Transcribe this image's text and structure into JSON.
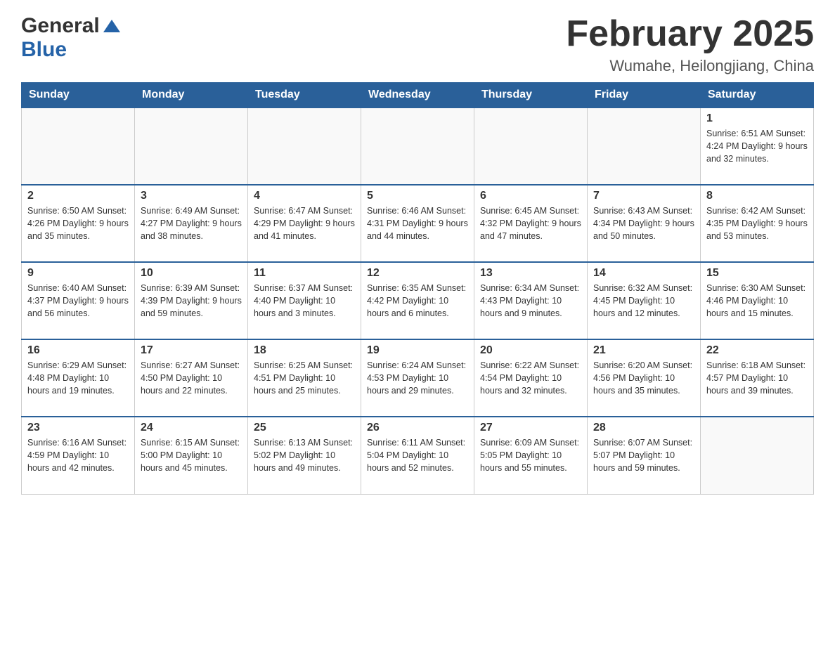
{
  "logo": {
    "general": "General",
    "blue": "Blue"
  },
  "header": {
    "title": "February 2025",
    "location": "Wumahe, Heilongjiang, China"
  },
  "weekdays": [
    "Sunday",
    "Monday",
    "Tuesday",
    "Wednesday",
    "Thursday",
    "Friday",
    "Saturday"
  ],
  "weeks": [
    [
      {
        "day": "",
        "info": ""
      },
      {
        "day": "",
        "info": ""
      },
      {
        "day": "",
        "info": ""
      },
      {
        "day": "",
        "info": ""
      },
      {
        "day": "",
        "info": ""
      },
      {
        "day": "",
        "info": ""
      },
      {
        "day": "1",
        "info": "Sunrise: 6:51 AM\nSunset: 4:24 PM\nDaylight: 9 hours and 32 minutes."
      }
    ],
    [
      {
        "day": "2",
        "info": "Sunrise: 6:50 AM\nSunset: 4:26 PM\nDaylight: 9 hours and 35 minutes."
      },
      {
        "day": "3",
        "info": "Sunrise: 6:49 AM\nSunset: 4:27 PM\nDaylight: 9 hours and 38 minutes."
      },
      {
        "day": "4",
        "info": "Sunrise: 6:47 AM\nSunset: 4:29 PM\nDaylight: 9 hours and 41 minutes."
      },
      {
        "day": "5",
        "info": "Sunrise: 6:46 AM\nSunset: 4:31 PM\nDaylight: 9 hours and 44 minutes."
      },
      {
        "day": "6",
        "info": "Sunrise: 6:45 AM\nSunset: 4:32 PM\nDaylight: 9 hours and 47 minutes."
      },
      {
        "day": "7",
        "info": "Sunrise: 6:43 AM\nSunset: 4:34 PM\nDaylight: 9 hours and 50 minutes."
      },
      {
        "day": "8",
        "info": "Sunrise: 6:42 AM\nSunset: 4:35 PM\nDaylight: 9 hours and 53 minutes."
      }
    ],
    [
      {
        "day": "9",
        "info": "Sunrise: 6:40 AM\nSunset: 4:37 PM\nDaylight: 9 hours and 56 minutes."
      },
      {
        "day": "10",
        "info": "Sunrise: 6:39 AM\nSunset: 4:39 PM\nDaylight: 9 hours and 59 minutes."
      },
      {
        "day": "11",
        "info": "Sunrise: 6:37 AM\nSunset: 4:40 PM\nDaylight: 10 hours and 3 minutes."
      },
      {
        "day": "12",
        "info": "Sunrise: 6:35 AM\nSunset: 4:42 PM\nDaylight: 10 hours and 6 minutes."
      },
      {
        "day": "13",
        "info": "Sunrise: 6:34 AM\nSunset: 4:43 PM\nDaylight: 10 hours and 9 minutes."
      },
      {
        "day": "14",
        "info": "Sunrise: 6:32 AM\nSunset: 4:45 PM\nDaylight: 10 hours and 12 minutes."
      },
      {
        "day": "15",
        "info": "Sunrise: 6:30 AM\nSunset: 4:46 PM\nDaylight: 10 hours and 15 minutes."
      }
    ],
    [
      {
        "day": "16",
        "info": "Sunrise: 6:29 AM\nSunset: 4:48 PM\nDaylight: 10 hours and 19 minutes."
      },
      {
        "day": "17",
        "info": "Sunrise: 6:27 AM\nSunset: 4:50 PM\nDaylight: 10 hours and 22 minutes."
      },
      {
        "day": "18",
        "info": "Sunrise: 6:25 AM\nSunset: 4:51 PM\nDaylight: 10 hours and 25 minutes."
      },
      {
        "day": "19",
        "info": "Sunrise: 6:24 AM\nSunset: 4:53 PM\nDaylight: 10 hours and 29 minutes."
      },
      {
        "day": "20",
        "info": "Sunrise: 6:22 AM\nSunset: 4:54 PM\nDaylight: 10 hours and 32 minutes."
      },
      {
        "day": "21",
        "info": "Sunrise: 6:20 AM\nSunset: 4:56 PM\nDaylight: 10 hours and 35 minutes."
      },
      {
        "day": "22",
        "info": "Sunrise: 6:18 AM\nSunset: 4:57 PM\nDaylight: 10 hours and 39 minutes."
      }
    ],
    [
      {
        "day": "23",
        "info": "Sunrise: 6:16 AM\nSunset: 4:59 PM\nDaylight: 10 hours and 42 minutes."
      },
      {
        "day": "24",
        "info": "Sunrise: 6:15 AM\nSunset: 5:00 PM\nDaylight: 10 hours and 45 minutes."
      },
      {
        "day": "25",
        "info": "Sunrise: 6:13 AM\nSunset: 5:02 PM\nDaylight: 10 hours and 49 minutes."
      },
      {
        "day": "26",
        "info": "Sunrise: 6:11 AM\nSunset: 5:04 PM\nDaylight: 10 hours and 52 minutes."
      },
      {
        "day": "27",
        "info": "Sunrise: 6:09 AM\nSunset: 5:05 PM\nDaylight: 10 hours and 55 minutes."
      },
      {
        "day": "28",
        "info": "Sunrise: 6:07 AM\nSunset: 5:07 PM\nDaylight: 10 hours and 59 minutes."
      },
      {
        "day": "",
        "info": ""
      }
    ]
  ]
}
